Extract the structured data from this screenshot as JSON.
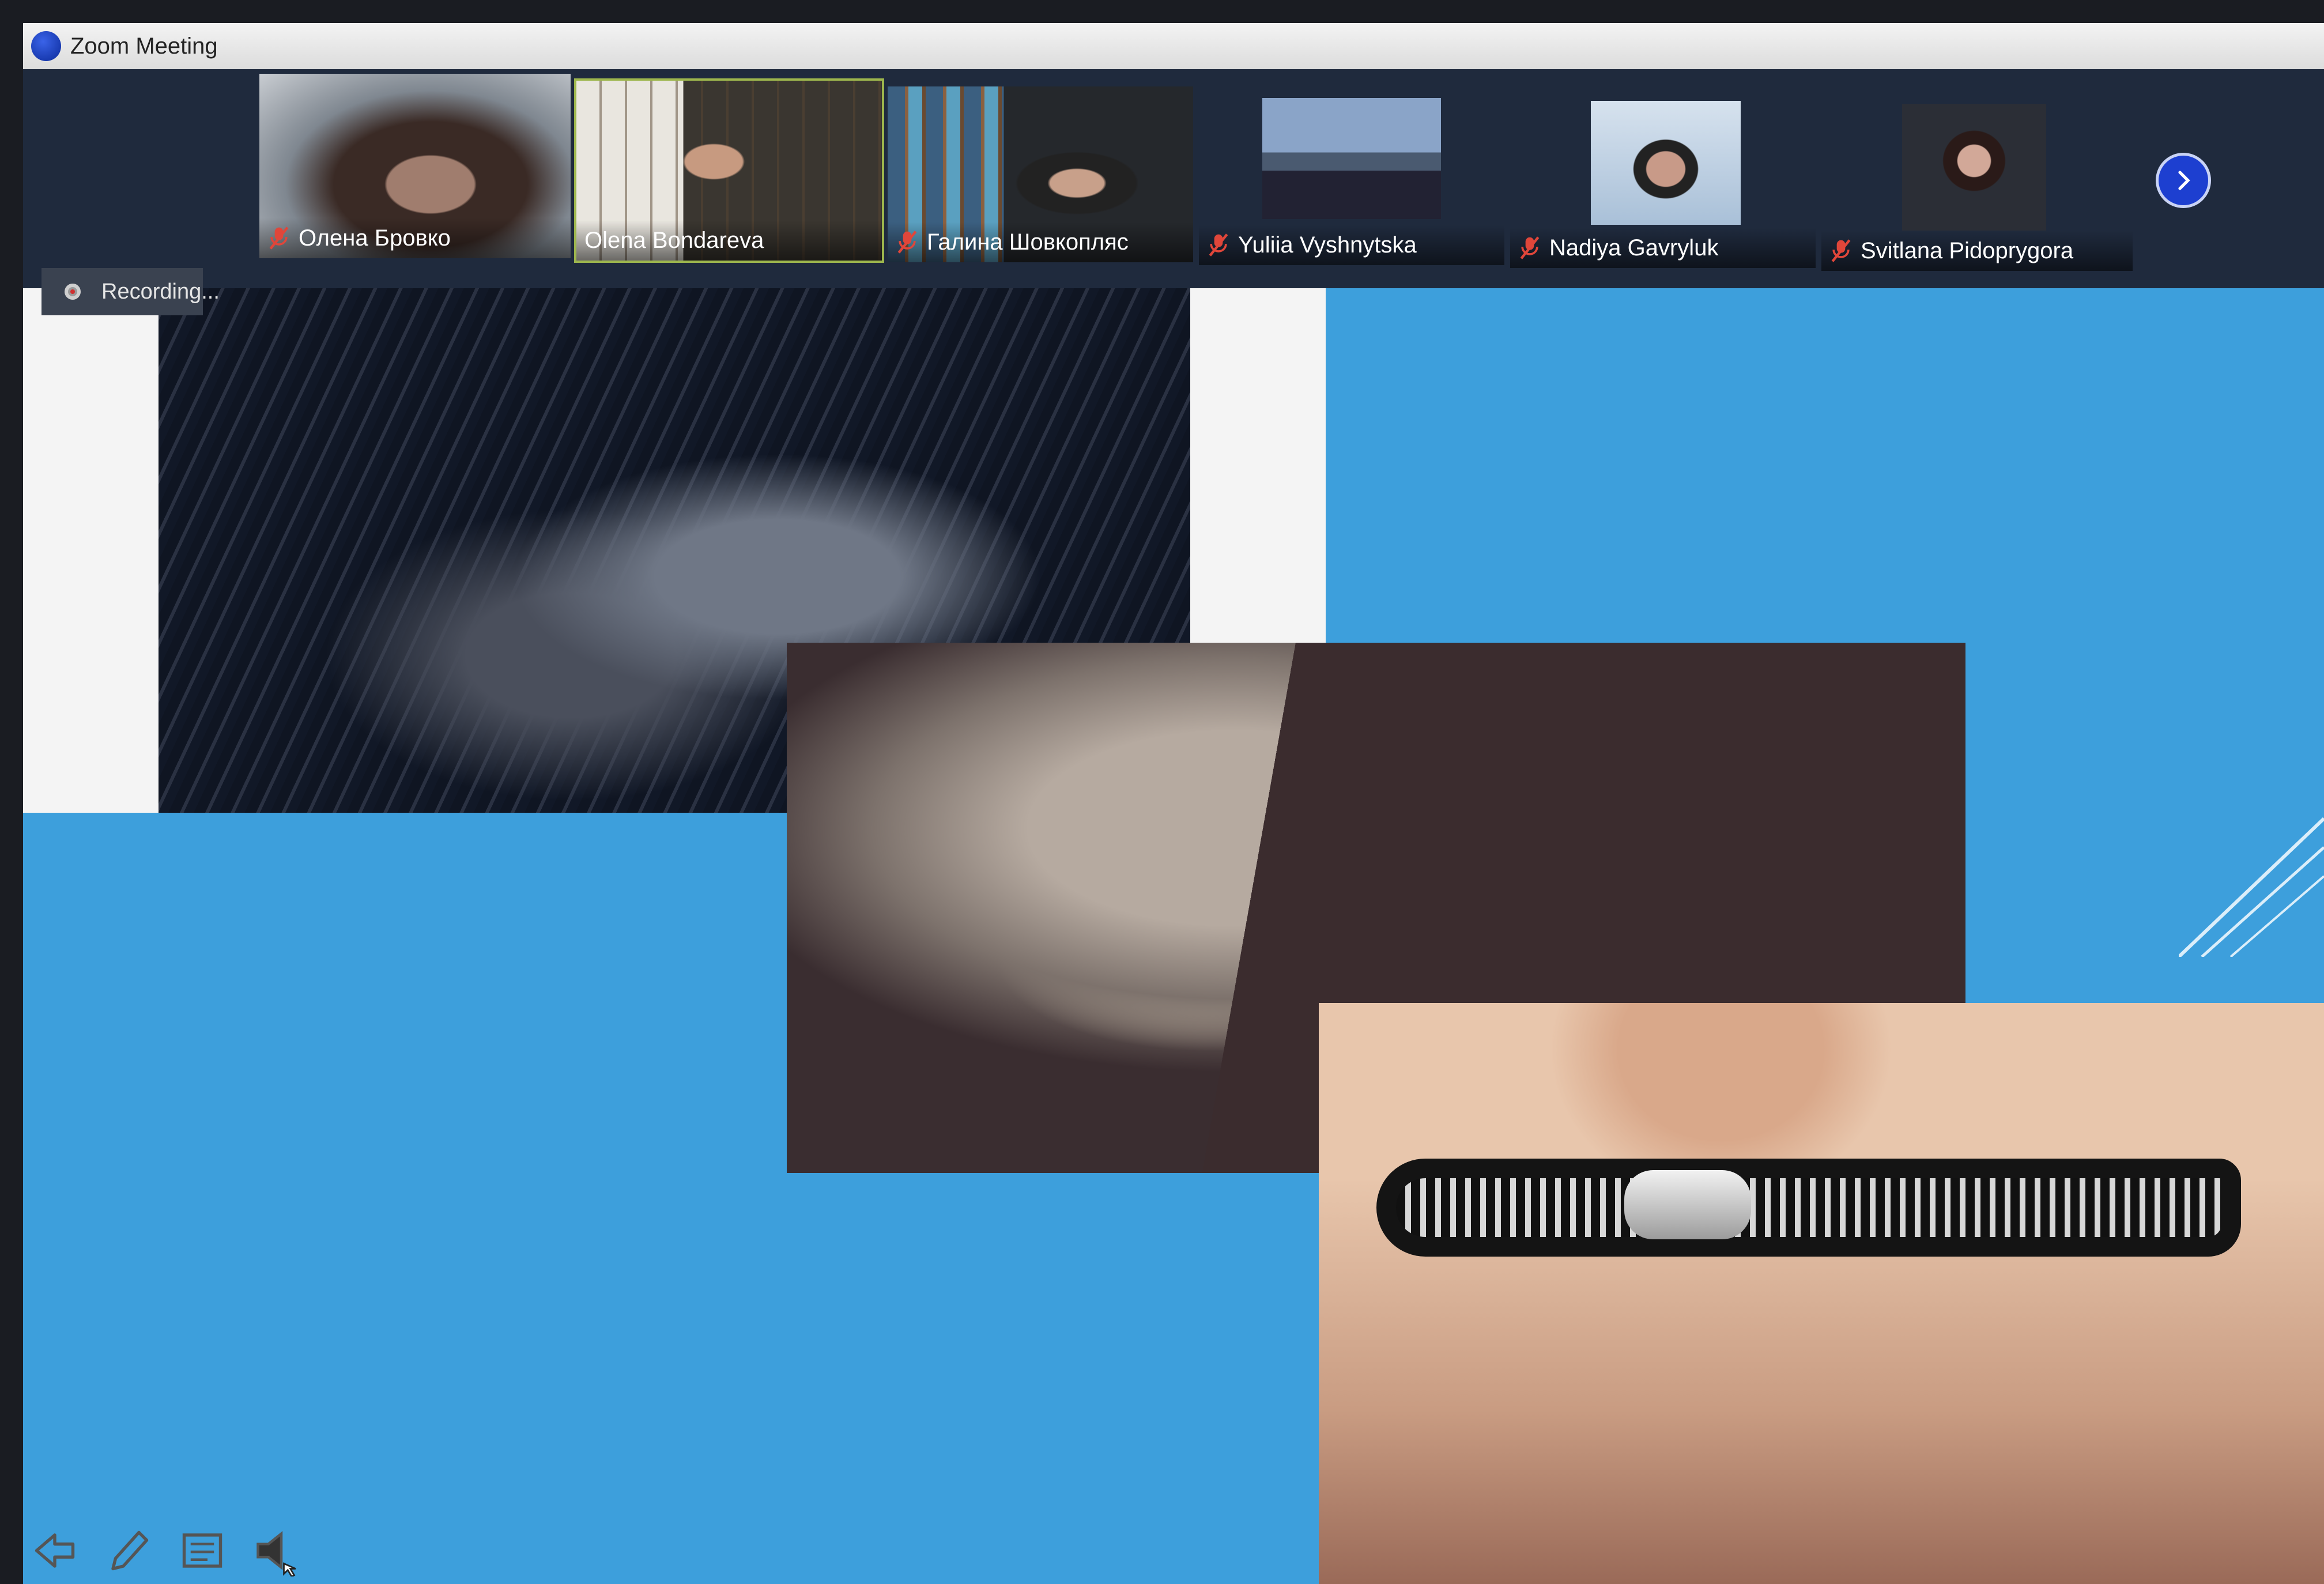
{
  "window": {
    "title": "Zoom Meeting",
    "icon": "zoom-app-icon"
  },
  "participants": [
    {
      "name": "Олена Бровко",
      "muted": true,
      "active": false
    },
    {
      "name": "Olena Bondareva",
      "muted": false,
      "active": true
    },
    {
      "name": "Галина Шовкопляс",
      "muted": true,
      "active": false
    },
    {
      "name": "Yuliia Vyshnytska",
      "muted": true,
      "active": false
    },
    {
      "name": "Nadiya Gavryluk",
      "muted": true,
      "active": false
    },
    {
      "name": "Svitlana Pidoprygora",
      "muted": true,
      "active": false
    }
  ],
  "recording": {
    "label": "Recording..."
  },
  "slide": {
    "background_color": "#3d9fdc",
    "images": [
      "woman-hair-covering-face",
      "finger-on-lips-shush",
      "zipper-mouth"
    ]
  },
  "toolbar": {
    "icons": [
      "back-arrow-icon",
      "pen-icon",
      "slides-icon",
      "speaker-icon"
    ]
  },
  "colors": {
    "accent": "#1d3fd0",
    "muted_red": "#e0463a",
    "active_border": "#9db64d"
  }
}
